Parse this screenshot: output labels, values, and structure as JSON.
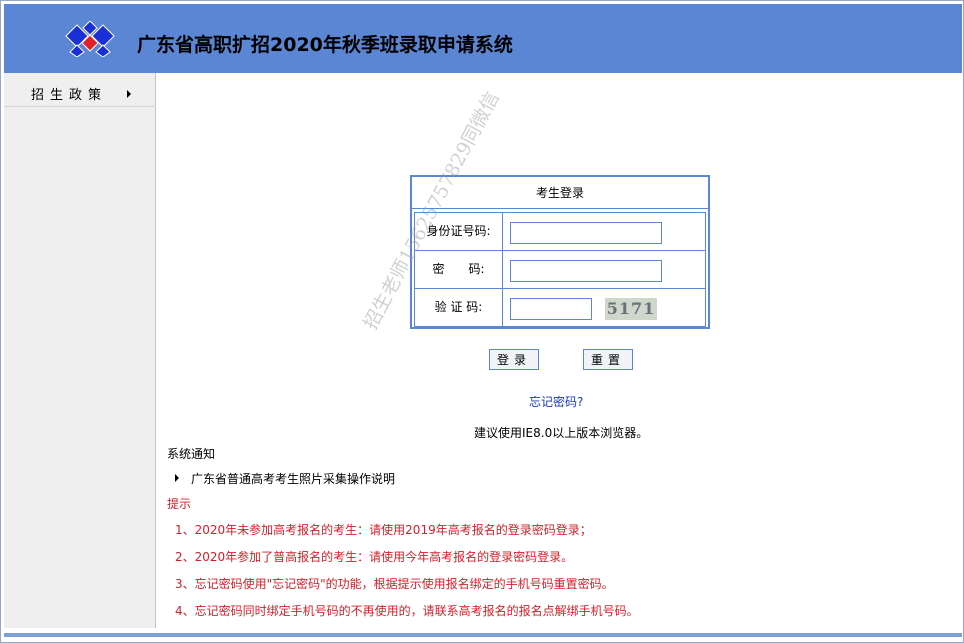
{
  "header": {
    "title": "广东省高职扩招2020年秋季班录取申请系统",
    "logo": "blue-diamond-logo",
    "colors": {
      "banner": "#5b86d4",
      "logo_blue": "#1a2fd6",
      "logo_red": "#e0202a"
    }
  },
  "sidebar": {
    "items": [
      {
        "label": "招生政策",
        "icon": "caret-right-icon"
      }
    ]
  },
  "login": {
    "title": "考生登录",
    "id_label": "身份证号码:",
    "password_label": "密　　码:",
    "captcha_label": "验 证 码:",
    "captcha_text": "5171",
    "id_value": "",
    "password_value": "",
    "captcha_value": "",
    "login_button": "登录",
    "reset_button": "重置",
    "forgot_link": "忘记密码?",
    "browser_tip": "建议使用IE8.0以上版本浏览器。"
  },
  "notice": {
    "title": "系统通知",
    "items": [
      {
        "text": "广东省普通高考考生照片采集操作说明",
        "icon": "caret-right-icon"
      }
    ]
  },
  "tips": {
    "title": "提示",
    "color": "#d0202a",
    "items": [
      "1、2020年未参加高考报名的考生：请使用2019年高考报名的登录密码登录；",
      "2、2020年参加了普高报名的考生：请使用今年高考报名的登录密码登录。",
      "3、忘记密码使用\"忘记密码\"的功能，根据提示使用报名绑定的手机号码重置密码。",
      "4、忘记密码同时绑定手机号码的不再使用的，请联系高考报名的报名点解绑手机号码。"
    ]
  },
  "watermark": "招生老师15625757829同微信"
}
